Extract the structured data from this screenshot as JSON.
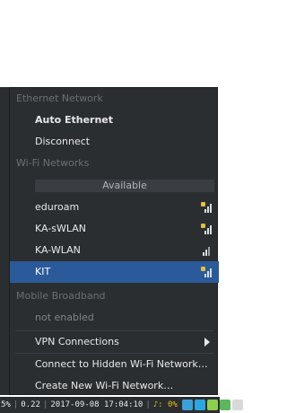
{
  "menu": {
    "ethernet_header": "Ethernet Network",
    "auto_ethernet": "Auto Ethernet",
    "disconnect": "Disconnect",
    "wifi_header": "Wi-Fi Networks",
    "available": "Available",
    "networks": [
      {
        "name": "eduroam",
        "secured": true
      },
      {
        "name": "KA-sWLAN",
        "secured": true
      },
      {
        "name": "KA-WLAN",
        "secured": false
      },
      {
        "name": "KIT",
        "secured": true,
        "selected": true
      }
    ],
    "mobile_header": "Mobile Broadband",
    "not_enabled": "not enabled",
    "vpn": "VPN Connections",
    "connect_hidden": "Connect to Hidden Wi-Fi Network…",
    "create_new": "Create New Wi-Fi Network…"
  },
  "taskbar": {
    "pct": "5%",
    "load": "0.22",
    "datetime": "2017-09-08 17:04:10",
    "volume_label": "♪: 0%",
    "icons": [
      "network-icon",
      "telegram-icon",
      "chrome-icon",
      "battery-icon",
      "update-icon"
    ]
  },
  "colors": {
    "menu_bg": "#2b2e31",
    "selection": "#2a5a9a",
    "header_text": "#6b6f73"
  }
}
